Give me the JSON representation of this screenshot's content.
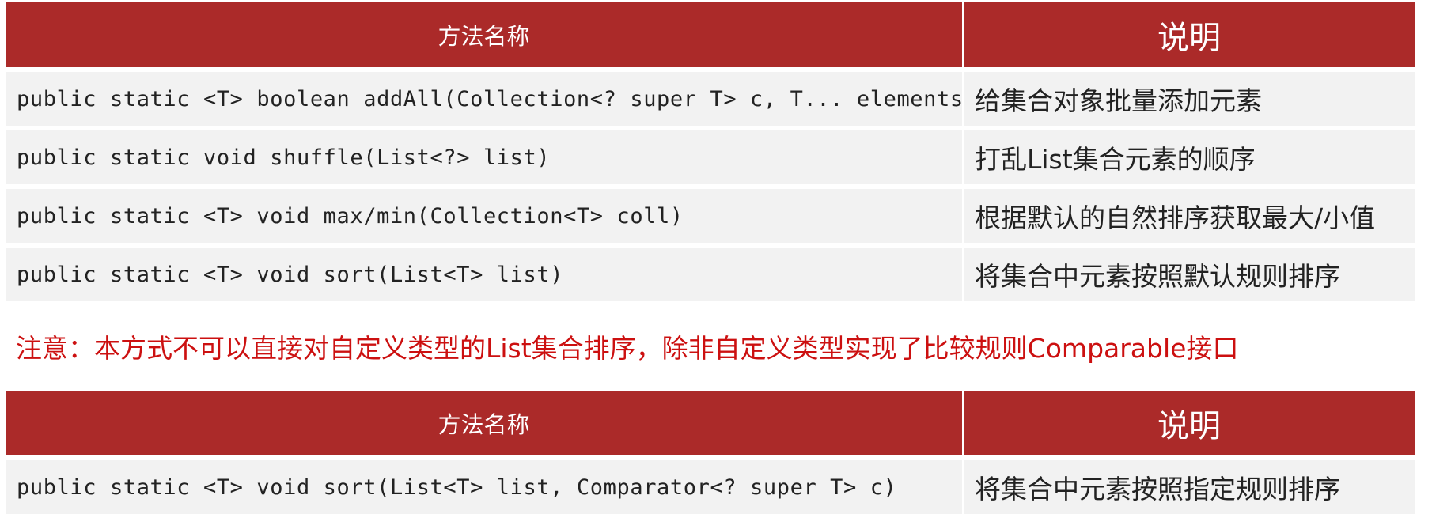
{
  "table1": {
    "header": {
      "method": "方法名称",
      "desc": "说明"
    },
    "rows": [
      {
        "method": "public static <T> boolean addAll(Collection<? super T> c, T... elements)",
        "desc": "给集合对象批量添加元素"
      },
      {
        "method": "public static void shuffle(List<?> list)",
        "desc": "打乱List集合元素的顺序"
      },
      {
        "method": "public static <T> void max/min(Collection<T> coll)",
        "desc": "根据默认的自然排序获取最大/小值"
      },
      {
        "method": "public static <T> void sort(List<T> list)",
        "desc": "将集合中元素按照默认规则排序"
      }
    ]
  },
  "note": "注意：本方式不可以直接对自定义类型的List集合排序，除非自定义类型实现了比较规则Comparable接口",
  "table2": {
    "header": {
      "method": "方法名称",
      "desc": "说明"
    },
    "rows": [
      {
        "method": "public static <T> void sort(List<T> list, Comparator<? super T> c)",
        "desc": "将集合中元素按照指定规则排序"
      }
    ]
  },
  "colors": {
    "header_bg": "#ab2a29",
    "row_bg": "#f2f2f2",
    "note_text": "#cc1010"
  }
}
